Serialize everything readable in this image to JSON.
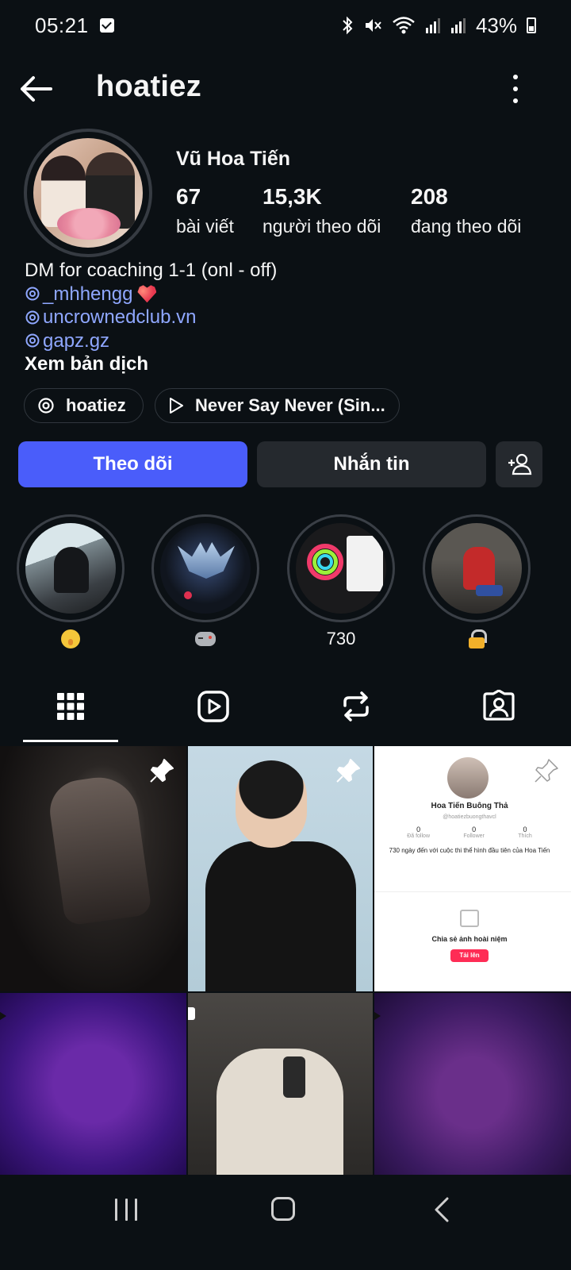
{
  "status_bar": {
    "time": "05:21",
    "battery": "43%"
  },
  "header": {
    "username": "hoatiez"
  },
  "profile": {
    "display_name": "Vũ Hoa Tiến",
    "stats": [
      {
        "value": "67",
        "label": "bài viết"
      },
      {
        "value": "15,3K",
        "label": "người theo dõi"
      },
      {
        "value": "208",
        "label": "đang theo dõi"
      }
    ],
    "bio_line": "DM for coaching 1-1 (onl - off)",
    "mentions": [
      "_mhhengg",
      "uncrownedclub.vn",
      "gapz.gz"
    ],
    "translate_label": "Xem bản dịch"
  },
  "chips": {
    "threads": "hoatiez",
    "music": "Never Say Never (Sin..."
  },
  "buttons": {
    "follow": "Theo dõi",
    "message": "Nhắn tin"
  },
  "highlights": [
    {
      "label": "",
      "icon": "shushing-face-emoji-icon"
    },
    {
      "label": "",
      "icon": "game-controller-emoji-icon"
    },
    {
      "label": "730",
      "icon": ""
    },
    {
      "label": "",
      "icon": "lock-emoji-icon"
    }
  ],
  "tiktok_post": {
    "name": "Hoa Tiến Buông Thả",
    "handle": "@hoatiezbuongthavcl",
    "stats": [
      {
        "value": "0",
        "label": "Đã follow"
      },
      {
        "value": "0",
        "label": "Follower"
      },
      {
        "value": "0",
        "label": "Thích"
      }
    ],
    "bio": "730 ngày đến với cuộc thi thể hình đầu tiên của Hoa Tiến",
    "share_text": "Chia sẻ ảnh hoài niệm",
    "upload_label": "Tải lên"
  },
  "colors": {
    "background": "#0b1014",
    "follow_button": "#4a5dfa",
    "secondary_button": "#25292e",
    "link": "#8fa7ff"
  }
}
